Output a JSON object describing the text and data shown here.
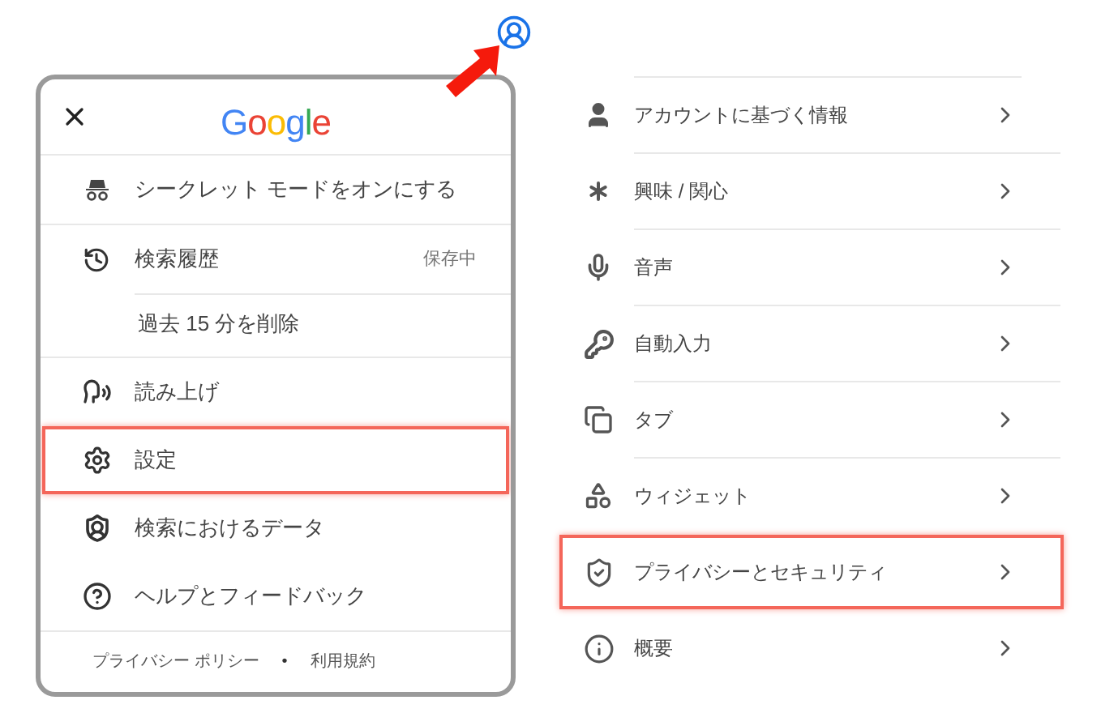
{
  "logo": [
    {
      "char": "G",
      "color": "#4285f4"
    },
    {
      "char": "o",
      "color": "#ea4335"
    },
    {
      "char": "o",
      "color": "#fbbc05"
    },
    {
      "char": "g",
      "color": "#4285f4"
    },
    {
      "char": "l",
      "color": "#34a853"
    },
    {
      "char": "e",
      "color": "#ea4335"
    }
  ],
  "menu": {
    "sections": [
      [
        {
          "label": "シークレット モードをオンにする",
          "highlighted": false
        }
      ],
      [
        {
          "label": "検索履歴",
          "status": "保存中",
          "highlighted": false,
          "children": [
            {
              "label": "過去 15 分を削除",
              "highlighted": false
            }
          ]
        }
      ],
      [
        {
          "label": "読み上げ",
          "highlighted": false
        },
        {
          "label": "設定",
          "highlighted": true
        },
        {
          "label": "検索におけるデータ",
          "highlighted": false
        },
        {
          "label": "ヘルプとフィードバック",
          "highlighted": false
        }
      ]
    ],
    "footer_links": [
      "プライバシー ポリシー",
      "利用規約"
    ],
    "footer_separator": "•"
  },
  "settings": [
    {
      "label": "アカウントに基づく情報",
      "highlighted": false
    },
    {
      "label": "興味 / 関心",
      "highlighted": false
    },
    {
      "label": "音声",
      "highlighted": false
    },
    {
      "label": "自動入力",
      "highlighted": false
    },
    {
      "label": "タブ",
      "highlighted": false
    },
    {
      "label": "ウィジェット",
      "highlighted": false
    },
    {
      "label": "プライバシーとセキュリティ",
      "highlighted": true
    },
    {
      "label": "概要",
      "highlighted": false
    }
  ]
}
